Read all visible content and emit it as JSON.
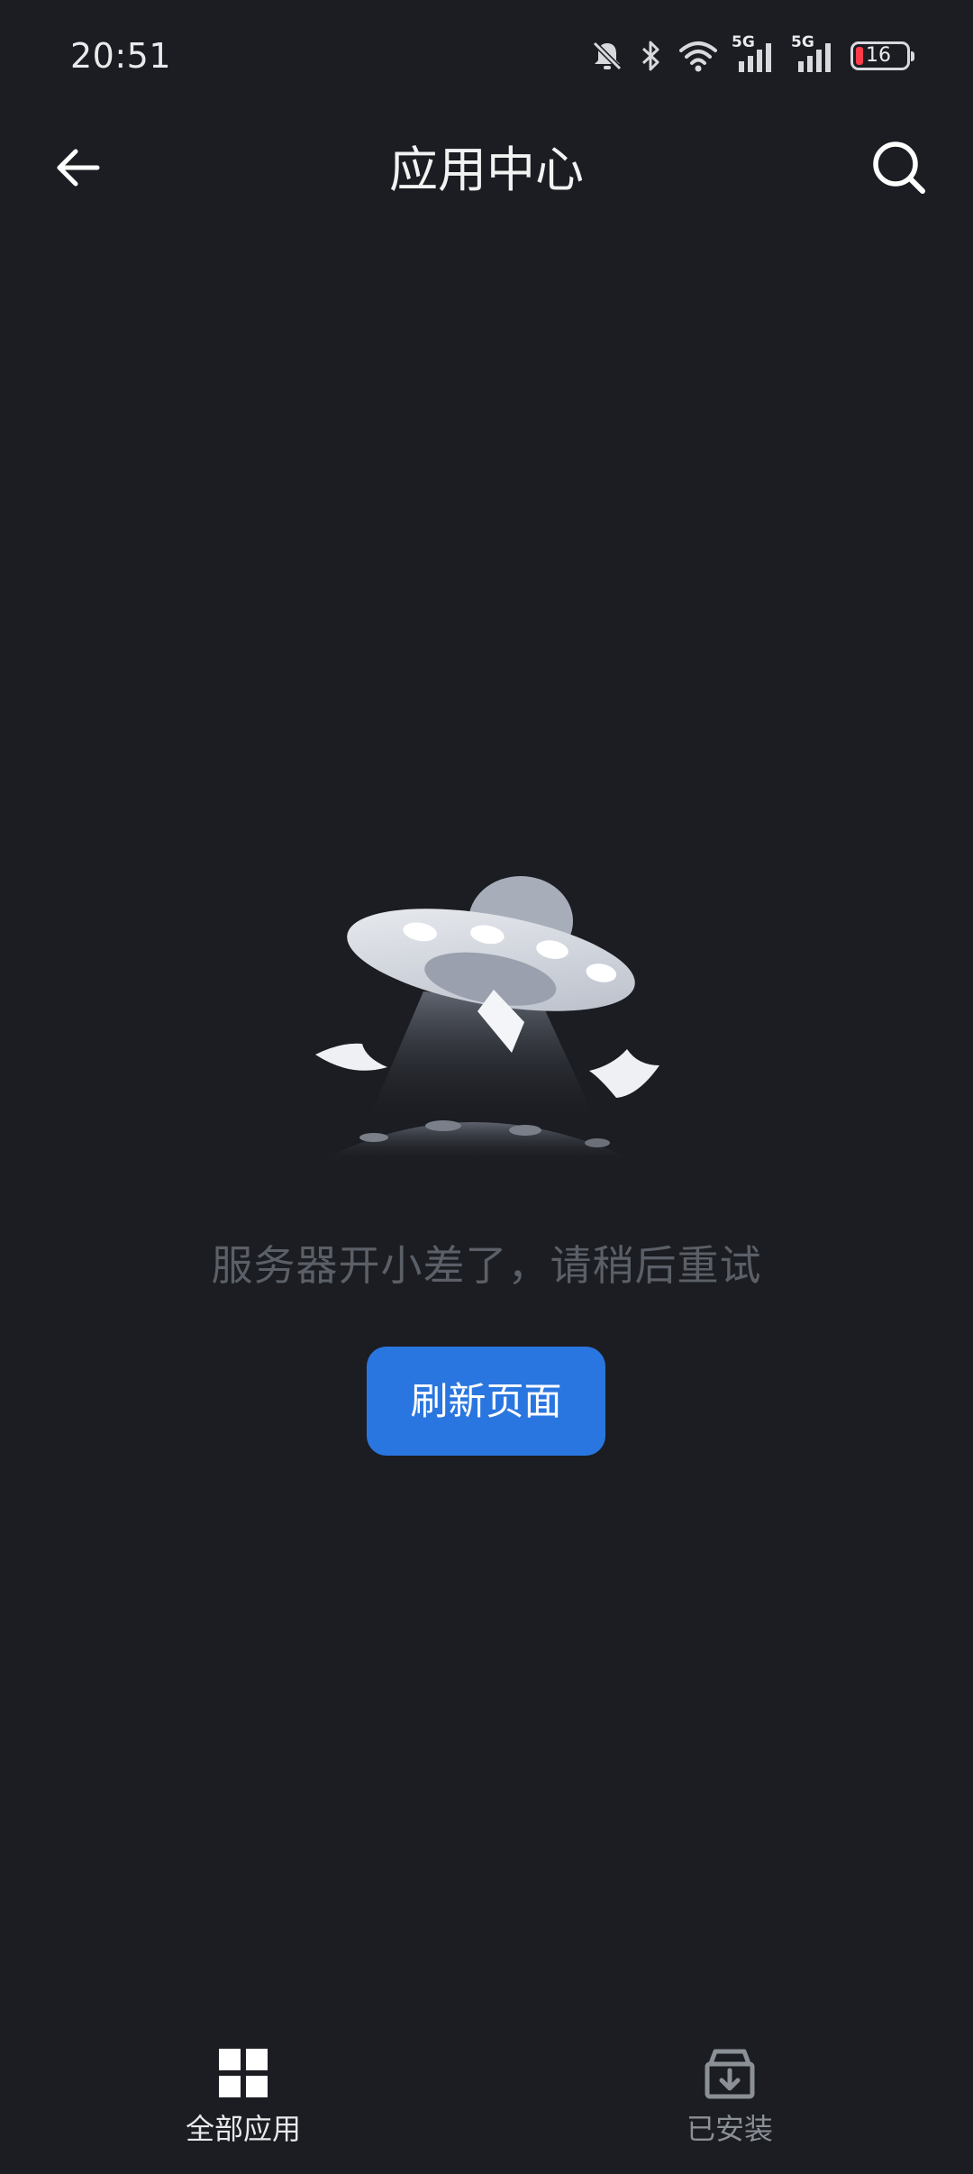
{
  "status_bar": {
    "time": "20:51",
    "icons": [
      "bell-muted-icon",
      "bluetooth-icon",
      "wifi-icon",
      "signal-5g-icon",
      "signal-5g-icon",
      "battery-icon"
    ],
    "signal_1_label": "5G",
    "signal_2_label": "5G",
    "battery_level": "16",
    "battery_color": "#ff3b4a"
  },
  "app_bar": {
    "title": "应用中心",
    "back_icon": "arrow-left-icon",
    "search_icon": "search-icon"
  },
  "empty_state": {
    "illustration": "ufo-illustration",
    "message": "服务器开小差了，请稍后重试",
    "refresh_label": "刷新页面",
    "button_color": "#2a76e0"
  },
  "bottom_nav": {
    "items": [
      {
        "label": "全部应用",
        "icon": "grid-icon",
        "active": true
      },
      {
        "label": "已安装",
        "icon": "install-box-icon",
        "active": false
      }
    ]
  },
  "colors": {
    "background": "#1b1d22",
    "accent": "#2a76e0",
    "muted_text": "#5b5f67"
  }
}
